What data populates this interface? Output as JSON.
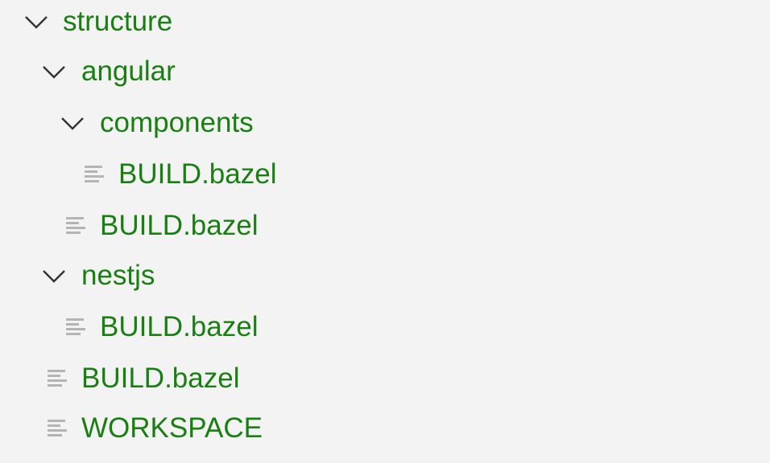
{
  "tree": {
    "colors": {
      "background": "#f3f3f3",
      "label": "#1a7f12",
      "chevron": "#333333",
      "file_icon": "#b4b4b4"
    },
    "items": [
      {
        "label": "structure",
        "type": "folder",
        "expanded": true,
        "depth": 0,
        "icon": "chevron-down-icon"
      },
      {
        "label": "angular",
        "type": "folder",
        "expanded": true,
        "depth": 1,
        "icon": "chevron-down-icon"
      },
      {
        "label": "components",
        "type": "folder",
        "expanded": true,
        "depth": 2,
        "icon": "chevron-down-icon"
      },
      {
        "label": "BUILD.bazel",
        "type": "file",
        "depth": 3,
        "icon": "file-lines-icon"
      },
      {
        "label": "BUILD.bazel",
        "type": "file",
        "depth": 2,
        "icon": "file-lines-icon"
      },
      {
        "label": "nestjs",
        "type": "folder",
        "expanded": true,
        "depth": 1,
        "icon": "chevron-down-icon"
      },
      {
        "label": "BUILD.bazel",
        "type": "file",
        "depth": 2,
        "icon": "file-lines-icon"
      },
      {
        "label": "BUILD.bazel",
        "type": "file",
        "depth": 1,
        "icon": "file-lines-icon"
      },
      {
        "label": "WORKSPACE",
        "type": "file",
        "depth": 1,
        "icon": "file-lines-icon"
      }
    ]
  }
}
